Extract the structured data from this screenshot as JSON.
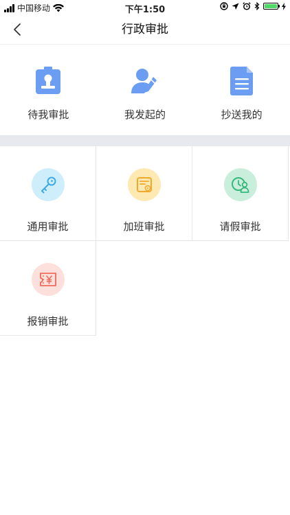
{
  "status_bar": {
    "carrier": "中国移动",
    "time": "下午1:50",
    "battery_color": "#4cd964"
  },
  "nav": {
    "title": "行政审批",
    "back_icon": "chevron-left-icon"
  },
  "quick_actions": [
    {
      "label": "待我审批",
      "icon": "badge-stamp-icon",
      "color": "#6b9df2"
    },
    {
      "label": "我发起的",
      "icon": "user-edit-icon",
      "color": "#6b9df2"
    },
    {
      "label": "抄送我的",
      "icon": "document-icon",
      "color": "#6b9df2"
    }
  ],
  "approval_types": [
    {
      "label": "通用审批",
      "icon": "key-icon",
      "bg": "#cfeefb",
      "fg": "#3fa9e8"
    },
    {
      "label": "加班审批",
      "icon": "overtime-card-icon",
      "bg": "#ffe9b3",
      "fg": "#f0a92c"
    },
    {
      "label": "请假审批",
      "icon": "clock-user-icon",
      "bg": "#c9efdc",
      "fg": "#37b77b"
    },
    {
      "label": "报销审批",
      "icon": "yen-ticket-icon",
      "bg": "#fde0dc",
      "fg": "#ee6b5b"
    }
  ],
  "colors": {
    "divider_band": "#e7e9ef",
    "cell_border": "#e7e7e7"
  }
}
